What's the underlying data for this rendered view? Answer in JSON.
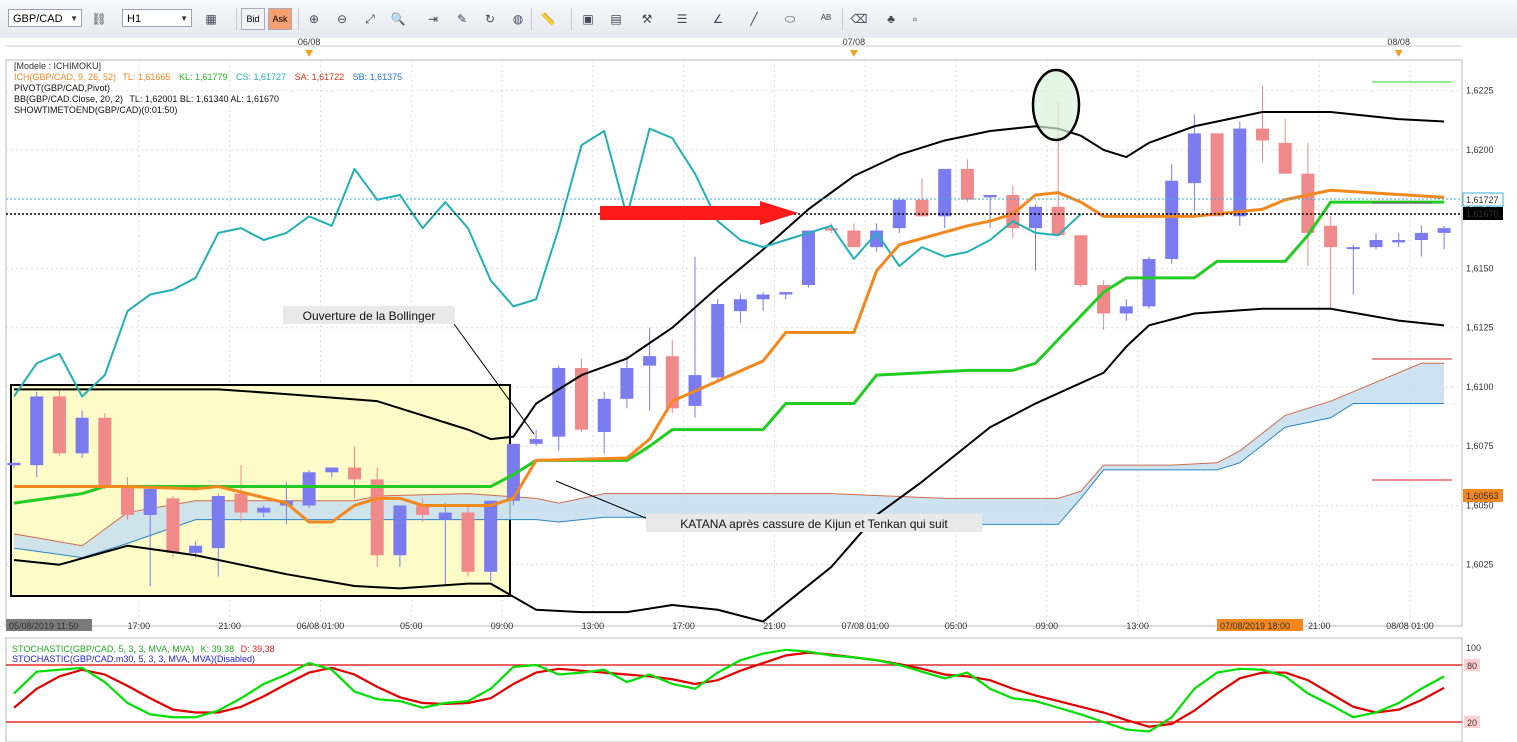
{
  "toolbar": {
    "symbol": "GBP/CAD",
    "timeframe": "H1",
    "bid_label": "Bid",
    "ask_label": "Ask"
  },
  "colors": {
    "bull": "#7b7bf0",
    "bear": "#f08a8a",
    "kijun": "#22cc22",
    "tenkan": "#f2881e",
    "chikou": "#22b0b8",
    "bollinger": "#000000",
    "cloud_fill": "#c6def0",
    "highlight": "#fdfbc8",
    "stoch_k": "#00e000",
    "stoch_d": "#e00000"
  },
  "chart_data": {
    "type": "candlestick",
    "symbol": "GBP/CAD",
    "timeframe": "H1",
    "legend": {
      "model": "[Modele : ICHIMOKU]",
      "ichimoku_prefix": "ICH(GBP/CAD, 9, 26, 52)",
      "ich_tl": "TL: 1,61665",
      "ich_kl": "KL: 1,61779",
      "ich_cs": "CS: 1,61727",
      "ich_sa": "SA: 1,61722",
      "ich_sb": "SB: 1,61375",
      "pivot": "PIVOT(GBP/CAD,Pivot)",
      "bb_prefix": "BB(GBP/CAD.Close, 20, 2)",
      "bb_values": "TL: 1,62001  BL: 1,61340  AL: 1,61670",
      "showtime": "SHOWTIMETOEND(GBP/CAD)(0:01:50)"
    },
    "y_ticks": [
      "1,6025",
      "1,6050",
      "1,6075",
      "1,6100",
      "1,6125",
      "1,6150",
      "1,6175",
      "1,6200",
      "1,6225"
    ],
    "ylim": [
      1.6008,
      1.6235
    ],
    "price_labels": {
      "current": "1,61670",
      "chikou": "1,61727",
      "lower": "1,60563"
    },
    "x_ticks": [
      {
        "i": 5.5,
        "label": "17:00"
      },
      {
        "i": 9.5,
        "label": "21:00"
      },
      {
        "i": 13.5,
        "label": "06/08 01:00"
      },
      {
        "i": 17.5,
        "label": "05:00"
      },
      {
        "i": 21.5,
        "label": "09:00"
      },
      {
        "i": 25.5,
        "label": "13:00"
      },
      {
        "i": 29.5,
        "label": "17:00"
      },
      {
        "i": 33.5,
        "label": "21:00"
      },
      {
        "i": 37.5,
        "label": "07/08 01:00"
      },
      {
        "i": 41.5,
        "label": "05:00"
      },
      {
        "i": 45.5,
        "label": "09:00"
      },
      {
        "i": 49.5,
        "label": "13:00"
      },
      {
        "i": 57.5,
        "label": "21:00"
      },
      {
        "i": 61.5,
        "label": "08/08 01:00"
      }
    ],
    "start_label": "05/08/2019 11:50",
    "cursor_label": "07/08/2019 18:00",
    "date_markers": [
      {
        "i": 13,
        "label": "06/08"
      },
      {
        "i": 37,
        "label": "07/08"
      },
      {
        "i": 61,
        "label": "08/08"
      }
    ],
    "ohlc": [
      [
        1.6067,
        1.6068,
        1.6066,
        1.6068
      ],
      [
        1.6067,
        1.6098,
        1.6062,
        1.6096
      ],
      [
        1.6096,
        1.6099,
        1.6071,
        1.6072
      ],
      [
        1.6072,
        1.609,
        1.607,
        1.6087
      ],
      [
        1.6087,
        1.6089,
        1.6057,
        1.6058
      ],
      [
        1.6058,
        1.6062,
        1.6044,
        1.6046
      ],
      [
        1.6046,
        1.6058,
        1.6016,
        1.6057
      ],
      [
        1.6053,
        1.6054,
        1.6028,
        1.603
      ],
      [
        1.603,
        1.6035,
        1.6028,
        1.6033
      ],
      [
        1.6032,
        1.6055,
        1.602,
        1.6054
      ],
      [
        1.6055,
        1.6067,
        1.6043,
        1.6047
      ],
      [
        1.6047,
        1.605,
        1.6045,
        1.6049
      ],
      [
        1.605,
        1.606,
        1.6042,
        1.6052
      ],
      [
        1.605,
        1.6065,
        1.6049,
        1.6064
      ],
      [
        1.6064,
        1.6066,
        1.6062,
        1.6066
      ],
      [
        1.6066,
        1.6075,
        1.6053,
        1.6061
      ],
      [
        1.6061,
        1.6066,
        1.6024,
        1.6029
      ],
      [
        1.6029,
        1.605,
        1.6024,
        1.605
      ],
      [
        1.605,
        1.6053,
        1.6043,
        1.6046
      ],
      [
        1.6044,
        1.6051,
        1.6016,
        1.6047
      ],
      [
        1.6047,
        1.605,
        1.602,
        1.6022
      ],
      [
        1.6022,
        1.6052,
        1.6018,
        1.6052
      ],
      [
        1.6052,
        1.6076,
        1.605,
        1.6076
      ],
      [
        1.6076,
        1.6082,
        1.6075,
        1.6078
      ],
      [
        1.6079,
        1.6109,
        1.6073,
        1.6108
      ],
      [
        1.6108,
        1.6112,
        1.6081,
        1.6082
      ],
      [
        1.6081,
        1.6098,
        1.6072,
        1.6095
      ],
      [
        1.6095,
        1.6113,
        1.6091,
        1.6108
      ],
      [
        1.6109,
        1.6125,
        1.609,
        1.6113
      ],
      [
        1.6113,
        1.612,
        1.6089,
        1.6091
      ],
      [
        1.6092,
        1.6155,
        1.6087,
        1.6105
      ],
      [
        1.6104,
        1.6137,
        1.6103,
        1.6135
      ],
      [
        1.6132,
        1.6139,
        1.6127,
        1.6137
      ],
      [
        1.6137,
        1.614,
        1.6132,
        1.6139
      ],
      [
        1.6139,
        1.614,
        1.6137,
        1.614
      ],
      [
        1.6143,
        1.6159,
        1.6142,
        1.6166
      ],
      [
        1.6167,
        1.6169,
        1.6165,
        1.6166
      ],
      [
        1.6166,
        1.6169,
        1.6159,
        1.6159
      ],
      [
        1.6159,
        1.6169,
        1.6157,
        1.6166
      ],
      [
        1.6167,
        1.618,
        1.6165,
        1.6179
      ],
      [
        1.6179,
        1.6188,
        1.6172,
        1.6172
      ],
      [
        1.6172,
        1.6192,
        1.6167,
        1.6192
      ],
      [
        1.6192,
        1.6196,
        1.6178,
        1.6179
      ],
      [
        1.618,
        1.6181,
        1.6167,
        1.6181
      ],
      [
        1.6181,
        1.6185,
        1.6163,
        1.6167
      ],
      [
        1.6167,
        1.6177,
        1.6149,
        1.6176
      ],
      [
        1.6176,
        1.622,
        1.6164,
        1.6164
      ],
      [
        1.6164,
        1.6164,
        1.6142,
        1.6143
      ],
      [
        1.6143,
        1.6145,
        1.6124,
        1.6131
      ],
      [
        1.6131,
        1.6137,
        1.6128,
        1.6134
      ],
      [
        1.6134,
        1.6155,
        1.6133,
        1.6154
      ],
      [
        1.6154,
        1.6194,
        1.6152,
        1.6187
      ],
      [
        1.6186,
        1.6215,
        1.6174,
        1.6207
      ],
      [
        1.6207,
        1.6207,
        1.6172,
        1.6172
      ],
      [
        1.6172,
        1.6212,
        1.6168,
        1.6209
      ],
      [
        1.6209,
        1.6227,
        1.6195,
        1.6204
      ],
      [
        1.6203,
        1.6213,
        1.619,
        1.619
      ],
      [
        1.619,
        1.6203,
        1.6151,
        1.6165
      ],
      [
        1.6168,
        1.6172,
        1.6133,
        1.6159
      ],
      [
        1.6159,
        1.616,
        1.6139,
        1.6159
      ],
      [
        1.6159,
        1.6165,
        1.6158,
        1.6162
      ],
      [
        1.6161,
        1.6165,
        1.6159,
        1.6162
      ],
      [
        1.6162,
        1.6168,
        1.6155,
        1.6165
      ],
      [
        1.6165,
        1.6168,
        1.6158,
        1.6167
      ]
    ],
    "kijun": [
      [
        0,
        1.6051
      ],
      [
        3,
        1.6055
      ],
      [
        4,
        1.6058
      ],
      [
        21,
        1.6058
      ],
      [
        22,
        1.6063
      ],
      [
        23,
        1.6069
      ],
      [
        27,
        1.6069
      ],
      [
        28,
        1.6075
      ],
      [
        29,
        1.6082
      ],
      [
        33,
        1.6082
      ],
      [
        34,
        1.6093
      ],
      [
        37,
        1.6093
      ],
      [
        38,
        1.6105
      ],
      [
        42,
        1.6107
      ],
      [
        44,
        1.6107
      ],
      [
        45,
        1.611
      ],
      [
        47,
        1.613
      ],
      [
        48,
        1.614
      ],
      [
        49,
        1.6146
      ],
      [
        52,
        1.6146
      ],
      [
        53,
        1.6153
      ],
      [
        56,
        1.6153
      ],
      [
        57,
        1.6164
      ],
      [
        58,
        1.6178
      ],
      [
        63,
        1.6178
      ]
    ],
    "tenkan": [
      [
        0,
        1.6058
      ],
      [
        5,
        1.6058
      ],
      [
        8,
        1.6057
      ],
      [
        9,
        1.6058
      ],
      [
        12,
        1.6051
      ],
      [
        13,
        1.6043
      ],
      [
        14,
        1.6043
      ],
      [
        15,
        1.605
      ],
      [
        16,
        1.6053
      ],
      [
        17,
        1.6053
      ],
      [
        18,
        1.605
      ],
      [
        19,
        1.605
      ],
      [
        20,
        1.605
      ],
      [
        21,
        1.605
      ],
      [
        22,
        1.6053
      ],
      [
        23,
        1.6069
      ],
      [
        27,
        1.607
      ],
      [
        28,
        1.6078
      ],
      [
        29,
        1.6094
      ],
      [
        33,
        1.6111
      ],
      [
        34,
        1.6123
      ],
      [
        37,
        1.6123
      ],
      [
        38,
        1.6149
      ],
      [
        39,
        1.616
      ],
      [
        42,
        1.6168
      ],
      [
        43,
        1.617
      ],
      [
        44,
        1.6173
      ],
      [
        45,
        1.6181
      ],
      [
        46,
        1.6182
      ],
      [
        47,
        1.6178
      ],
      [
        48,
        1.6172
      ],
      [
        52,
        1.6172
      ],
      [
        53,
        1.6173
      ],
      [
        54,
        1.6174
      ],
      [
        55,
        1.6175
      ],
      [
        56,
        1.6179
      ],
      [
        58,
        1.6183
      ],
      [
        63,
        1.618
      ]
    ],
    "chikou": [
      [
        0,
        1.6096
      ],
      [
        1,
        1.611
      ],
      [
        2,
        1.6114
      ],
      [
        3,
        1.6096
      ],
      [
        4,
        1.6105
      ],
      [
        5,
        1.6132
      ],
      [
        6,
        1.6139
      ],
      [
        7,
        1.6141
      ],
      [
        8,
        1.6146
      ],
      [
        9,
        1.6165
      ],
      [
        10,
        1.6167
      ],
      [
        11,
        1.6162
      ],
      [
        12,
        1.6165
      ],
      [
        13,
        1.6172
      ],
      [
        14,
        1.6168
      ],
      [
        15,
        1.6192
      ],
      [
        16,
        1.6179
      ],
      [
        17,
        1.6181
      ],
      [
        18,
        1.6167
      ],
      [
        19,
        1.6178
      ],
      [
        20,
        1.6167
      ],
      [
        21,
        1.6145
      ],
      [
        22,
        1.6134
      ],
      [
        23,
        1.6137
      ],
      [
        24,
        1.6167
      ],
      [
        25,
        1.6202
      ],
      [
        26,
        1.6208
      ],
      [
        27,
        1.6172
      ],
      [
        28,
        1.6209
      ],
      [
        29,
        1.6205
      ],
      [
        30,
        1.619
      ],
      [
        31,
        1.617
      ],
      [
        32,
        1.6162
      ],
      [
        33,
        1.6159
      ],
      [
        34,
        1.6162
      ],
      [
        35,
        1.6165
      ],
      [
        36,
        1.6168
      ],
      [
        37,
        1.6154
      ],
      [
        38,
        1.6165
      ],
      [
        39,
        1.6151
      ],
      [
        40,
        1.6159
      ],
      [
        41,
        1.6155
      ],
      [
        42,
        1.6157
      ],
      [
        43,
        1.6162
      ],
      [
        44,
        1.617
      ],
      [
        45,
        1.6165
      ],
      [
        46,
        1.6164
      ],
      [
        47,
        1.6173
      ]
    ],
    "bb_upper": [
      [
        0,
        1.6099
      ],
      [
        5,
        1.6099
      ],
      [
        9,
        1.6099
      ],
      [
        12,
        1.6097
      ],
      [
        16,
        1.6094
      ],
      [
        20,
        1.6082
      ],
      [
        21,
        1.6078
      ],
      [
        22,
        1.6079
      ],
      [
        23,
        1.6093
      ],
      [
        25,
        1.6105
      ],
      [
        27,
        1.6112
      ],
      [
        29,
        1.6125
      ],
      [
        31,
        1.6142
      ],
      [
        33,
        1.6158
      ],
      [
        35,
        1.6175
      ],
      [
        37,
        1.6189
      ],
      [
        39,
        1.6198
      ],
      [
        41,
        1.6204
      ],
      [
        43,
        1.6208
      ],
      [
        45,
        1.621
      ],
      [
        46,
        1.6209
      ],
      [
        47,
        1.6206
      ],
      [
        48,
        1.62
      ],
      [
        49,
        1.6197
      ],
      [
        50,
        1.6203
      ],
      [
        52,
        1.621
      ],
      [
        55,
        1.6216
      ],
      [
        58,
        1.6216
      ],
      [
        61,
        1.6213
      ],
      [
        63,
        1.6212
      ]
    ],
    "bb_lower": [
      [
        0,
        1.6027
      ],
      [
        2,
        1.6025
      ],
      [
        5,
        1.6033
      ],
      [
        8,
        1.6029
      ],
      [
        12,
        1.6021
      ],
      [
        15,
        1.6016
      ],
      [
        17,
        1.6015
      ],
      [
        20,
        1.6017
      ],
      [
        21,
        1.6017
      ],
      [
        23,
        1.6006
      ],
      [
        25,
        1.6005
      ],
      [
        27,
        1.6005
      ],
      [
        29,
        1.6008
      ],
      [
        31,
        1.6006
      ],
      [
        33,
        1.6001
      ],
      [
        36,
        1.6024
      ],
      [
        38,
        1.6046
      ],
      [
        40,
        1.606
      ],
      [
        43,
        1.6083
      ],
      [
        45,
        1.6093
      ],
      [
        48,
        1.6106
      ],
      [
        49,
        1.6117
      ],
      [
        50,
        1.6126
      ],
      [
        52,
        1.6131
      ],
      [
        55,
        1.6133
      ],
      [
        58,
        1.6133
      ],
      [
        61,
        1.6128
      ],
      [
        63,
        1.6126
      ]
    ],
    "span_a": [
      [
        0,
        1.6038
      ],
      [
        3,
        1.6033
      ],
      [
        5,
        1.6047
      ],
      [
        8,
        1.6052
      ],
      [
        15,
        1.6052
      ],
      [
        16,
        1.6054
      ],
      [
        20,
        1.6055
      ],
      [
        23,
        1.6053
      ],
      [
        24,
        1.6051
      ],
      [
        26,
        1.6055
      ],
      [
        36,
        1.6055
      ],
      [
        41,
        1.6053
      ],
      [
        46,
        1.6053
      ],
      [
        47,
        1.6056
      ],
      [
        48,
        1.6067
      ],
      [
        51,
        1.6067
      ],
      [
        53,
        1.6068
      ],
      [
        54,
        1.6073
      ],
      [
        56,
        1.6088
      ],
      [
        58,
        1.6094
      ],
      [
        62,
        1.611
      ],
      [
        63,
        1.611
      ]
    ],
    "span_b": [
      [
        0,
        1.6032
      ],
      [
        3,
        1.6028
      ],
      [
        5,
        1.6034
      ],
      [
        8,
        1.6044
      ],
      [
        15,
        1.6044
      ],
      [
        20,
        1.6044
      ],
      [
        23,
        1.6044
      ],
      [
        24,
        1.6043
      ],
      [
        26,
        1.6045
      ],
      [
        36,
        1.6045
      ],
      [
        41,
        1.6042
      ],
      [
        46,
        1.6042
      ],
      [
        47,
        1.6053
      ],
      [
        48,
        1.6065
      ],
      [
        51,
        1.6065
      ],
      [
        53,
        1.6065
      ],
      [
        54,
        1.6068
      ],
      [
        56,
        1.6083
      ],
      [
        58,
        1.6087
      ],
      [
        59,
        1.6093
      ],
      [
        63,
        1.6093
      ]
    ],
    "stoch_k": [
      0.5,
      0.73,
      0.75,
      0.77,
      0.62,
      0.4,
      0.28,
      0.25,
      0.25,
      0.32,
      0.45,
      0.6,
      0.7,
      0.82,
      0.75,
      0.52,
      0.44,
      0.42,
      0.35,
      0.4,
      0.42,
      0.55,
      0.78,
      0.8,
      0.7,
      0.72,
      0.75,
      0.62,
      0.7,
      0.6,
      0.55,
      0.72,
      0.85,
      0.92,
      0.96,
      0.94,
      0.9,
      0.88,
      0.85,
      0.8,
      0.73,
      0.66,
      0.72,
      0.55,
      0.45,
      0.42,
      0.35,
      0.28,
      0.2,
      0.12,
      0.1,
      0.25,
      0.55,
      0.72,
      0.76,
      0.75,
      0.68,
      0.5,
      0.38,
      0.25,
      0.3,
      0.4,
      0.55,
      0.68
    ],
    "stoch_d": [
      0.35,
      0.55,
      0.68,
      0.75,
      0.7,
      0.58,
      0.45,
      0.33,
      0.3,
      0.3,
      0.36,
      0.47,
      0.6,
      0.72,
      0.77,
      0.7,
      0.57,
      0.46,
      0.4,
      0.39,
      0.4,
      0.45,
      0.6,
      0.72,
      0.76,
      0.74,
      0.72,
      0.7,
      0.68,
      0.65,
      0.6,
      0.64,
      0.74,
      0.82,
      0.9,
      0.93,
      0.91,
      0.88,
      0.85,
      0.81,
      0.76,
      0.7,
      0.68,
      0.64,
      0.55,
      0.48,
      0.42,
      0.36,
      0.3,
      0.22,
      0.15,
      0.18,
      0.32,
      0.5,
      0.66,
      0.72,
      0.72,
      0.64,
      0.5,
      0.36,
      0.3,
      0.33,
      0.43,
      0.56
    ],
    "stoch_legend1": "STOCHASTIC(GBP/CAD, 5, 3, 3, MVA, MVA)",
    "stoch_legend1_k": "K: 39,38",
    "stoch_legend1_d": "D: 39,38",
    "stoch_legend2": "STOCHASTIC(GBP/CAD.m30, 5, 3, 3, MVA, MVA)(Disabled)",
    "stoch_levels": {
      "high": "80",
      "low": "20",
      "top": "100"
    },
    "annotations": {
      "bollinger": "Ouverture de la Bollinger",
      "katana": "KATANA après cassure de Kijun et Tenkan qui suit"
    }
  }
}
